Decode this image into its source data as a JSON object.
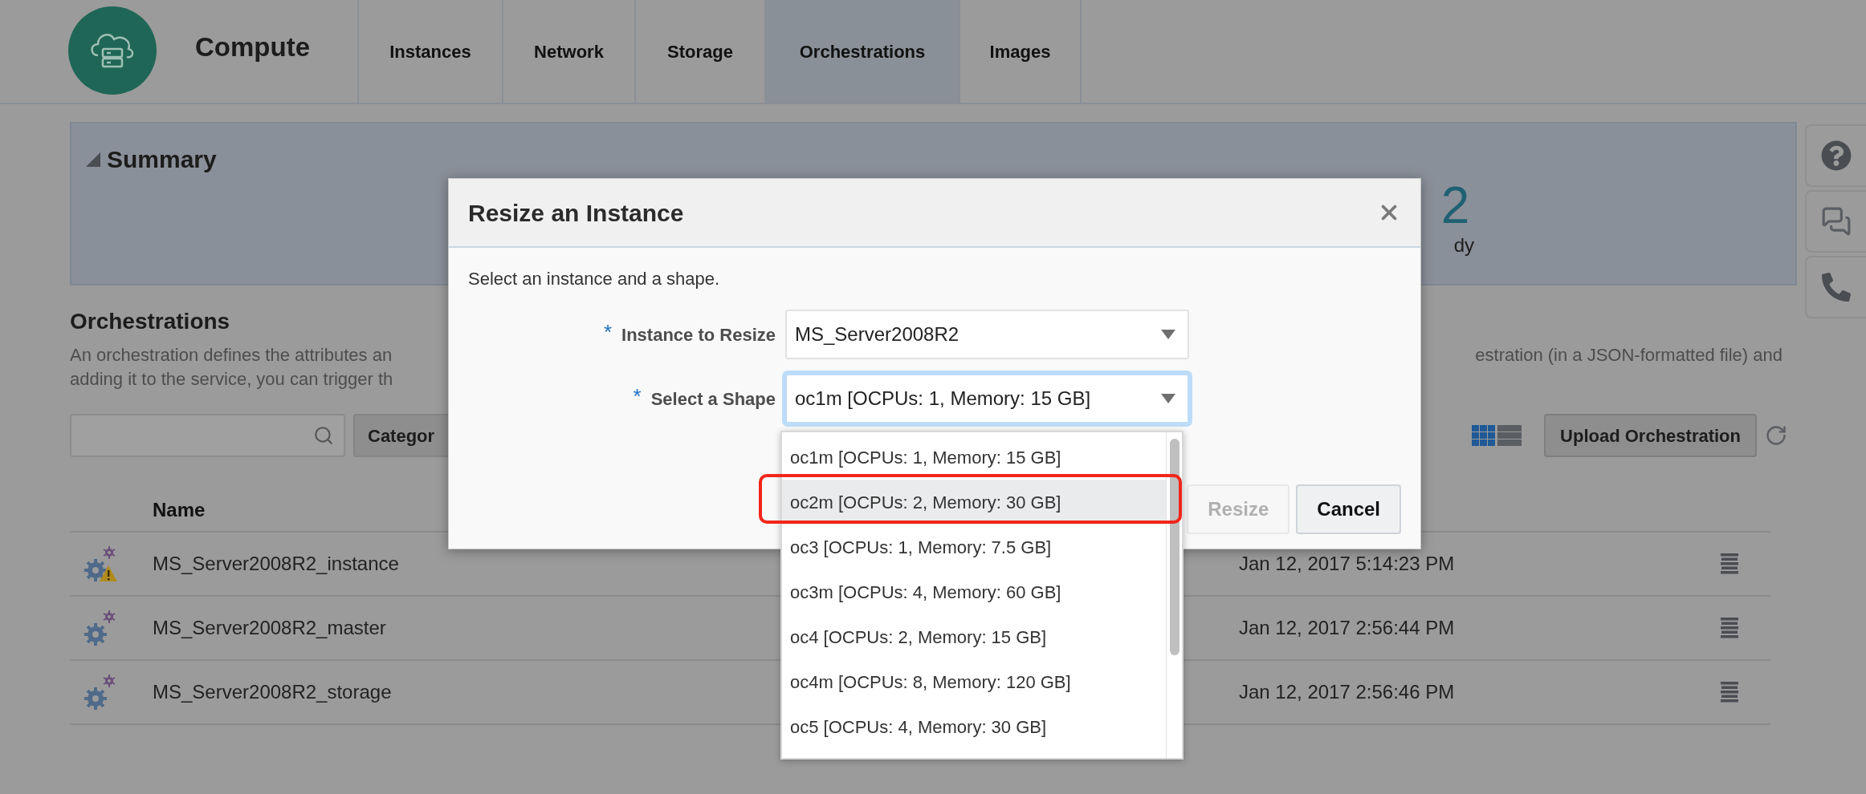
{
  "header": {
    "product": "Compute",
    "tabs": [
      {
        "label": "Instances",
        "selected": false
      },
      {
        "label": "Network",
        "selected": false
      },
      {
        "label": "Storage",
        "selected": false
      },
      {
        "label": "Orchestrations",
        "selected": true
      },
      {
        "label": "Images",
        "selected": false
      }
    ]
  },
  "summary": {
    "title": "Summary",
    "count_fragment": "2",
    "label_fragment": "dy"
  },
  "section": {
    "title": "Orchestrations",
    "description_line_1_start": "An orchestration defines the attributes an",
    "description_line_1_end": "estration (in a JSON-formatted file) and",
    "description_line_2_start": "adding it to the service, you can trigger th"
  },
  "toolbar": {
    "category_button": "Categor",
    "view_toggle": [
      {
        "kind": "grid",
        "selected": true
      },
      {
        "kind": "list",
        "selected": false
      }
    ],
    "upload_button": "Upload Orchestration"
  },
  "table": {
    "columns": [
      "Name"
    ],
    "rows": [
      {
        "name": "MS_Server2008R2_instance",
        "date": "Jan 12, 2017 5:14:23 PM",
        "warning": true
      },
      {
        "name": "MS_Server2008R2_master",
        "date": "Jan 12, 2017 2:56:44 PM",
        "warning": false
      },
      {
        "name": "MS_Server2008R2_storage",
        "date": "Jan 12, 2017 2:56:46 PM",
        "warning": false
      }
    ]
  },
  "dialog": {
    "title": "Resize an Instance",
    "intro": "Select an instance and a shape.",
    "fields": [
      {
        "required_mark": "*",
        "label": "Instance to Resize",
        "value": "MS_Server2008R2",
        "focused": false
      },
      {
        "required_mark": "*",
        "label": "Select a Shape",
        "value": "oc1m [OCPUs: 1, Memory: 15 GB]",
        "focused": true
      }
    ],
    "buttons": [
      {
        "label": "Resize",
        "disabled": true
      },
      {
        "label": "Cancel",
        "disabled": false
      }
    ],
    "dropdown": {
      "options": [
        {
          "label": "oc1m [OCPUs: 1, Memory: 15 GB]",
          "highlighted": false,
          "circled": false
        },
        {
          "label": "oc2m [OCPUs: 2, Memory: 30 GB]",
          "highlighted": true,
          "circled": true
        },
        {
          "label": "oc3 [OCPUs: 1, Memory: 7.5 GB]",
          "highlighted": false,
          "circled": false
        },
        {
          "label": "oc3m [OCPUs: 4, Memory: 60 GB]",
          "highlighted": false,
          "circled": false
        },
        {
          "label": "oc4 [OCPUs: 2, Memory: 15 GB]",
          "highlighted": false,
          "circled": false
        },
        {
          "label": "oc4m [OCPUs: 8, Memory: 120 GB]",
          "highlighted": false,
          "circled": false
        },
        {
          "label": "oc5 [OCPUs: 4, Memory: 30 GB]",
          "highlighted": false,
          "circled": false
        }
      ]
    }
  }
}
